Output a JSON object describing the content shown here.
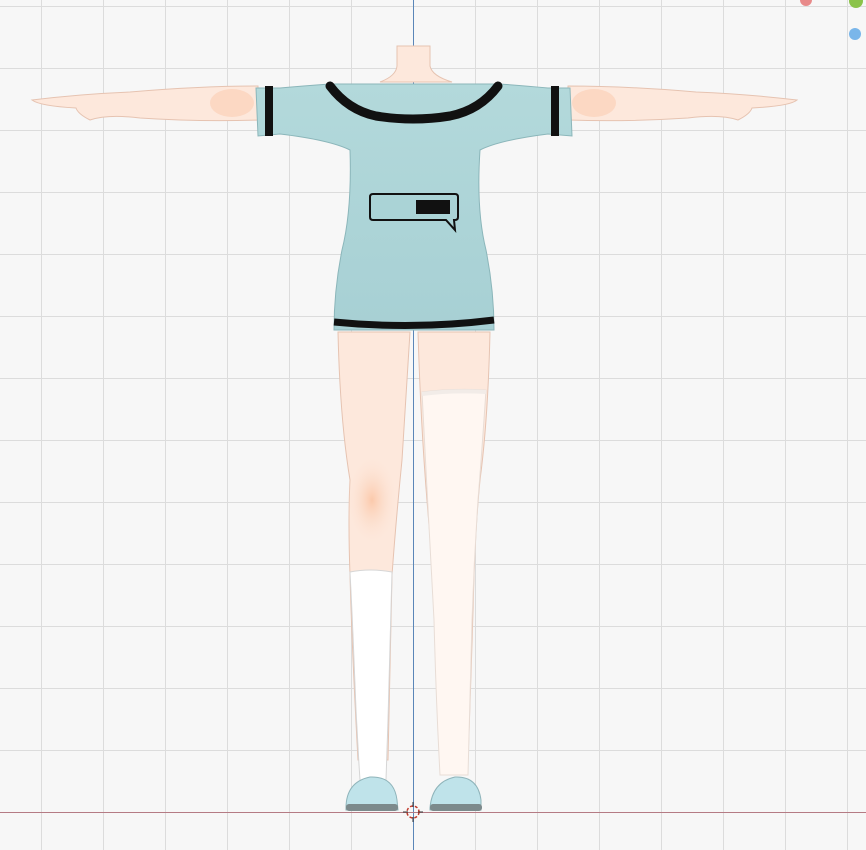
{
  "viewport": {
    "background": "#f7f7f7",
    "grid_color": "#dcdcdc",
    "axis_y_color": "#5a86b8",
    "axis_x_color": "#b57b84"
  },
  "gizmo": {
    "x_color": "#e88a8a",
    "y_color": "#8bc34a",
    "z_color": "#7ab6ea",
    "y_icon": "axis-y-icon"
  },
  "model": {
    "skin_color": "#fde8dc",
    "shirt_color": "#add5d8",
    "trim_color": "#111111",
    "sock_color": "#ffffff",
    "slipper_color": "#bfe3ea"
  }
}
